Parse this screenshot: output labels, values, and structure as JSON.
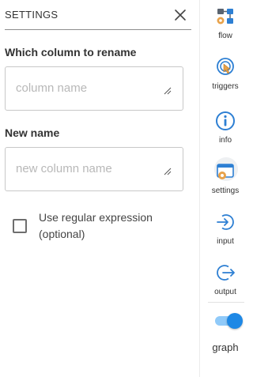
{
  "settings_panel": {
    "title": "SETTINGS",
    "fields": [
      {
        "label": "Which column to rename",
        "placeholder": "column name",
        "value": ""
      },
      {
        "label": "New name",
        "placeholder": "new column name",
        "value": ""
      }
    ],
    "regex_option": {
      "label": "Use regular expression (optional)",
      "checked": false
    }
  },
  "sidebar": {
    "items": [
      {
        "label": "flow",
        "icon": "flow-icon"
      },
      {
        "label": "triggers",
        "icon": "triggers-icon"
      },
      {
        "label": "info",
        "icon": "info-icon"
      },
      {
        "label": "settings",
        "icon": "settings-icon",
        "active": true
      },
      {
        "label": "input",
        "icon": "input-icon"
      },
      {
        "label": "output",
        "icon": "output-icon"
      }
    ],
    "graph_toggle": {
      "label": "graph",
      "on": true
    }
  },
  "colors": {
    "accent": "#1e88e5",
    "accent_light": "#90caf9",
    "icon_orange": "#e8a24a"
  }
}
